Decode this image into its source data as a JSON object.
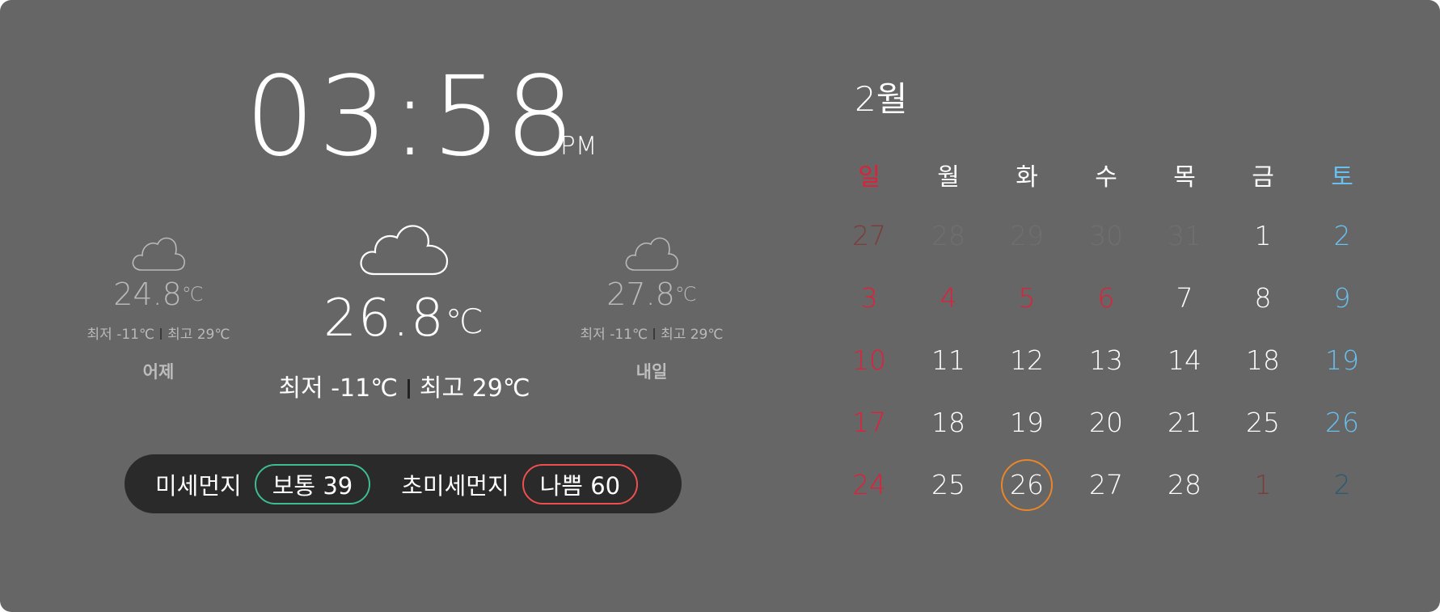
{
  "clock": {
    "time": "03:58",
    "ampm": "PM"
  },
  "weather": {
    "yesterday": {
      "icon": "cloud-icon",
      "temp": "24.8",
      "unit": "℃",
      "low": "최저 -11℃",
      "high": "최고 29℃",
      "day": "어제"
    },
    "today": {
      "icon": "cloud-icon",
      "temp": "26.8",
      "unit": "℃",
      "low": "최저 -11℃",
      "high": "최고 29℃"
    },
    "tomorrow": {
      "icon": "cloud-icon",
      "temp": "27.8",
      "unit": "℃",
      "low": "최저 -11℃",
      "high": "최고 29℃",
      "day": "내일"
    }
  },
  "air": {
    "pm10_label": "미세먼지",
    "pm10_value": "보통 39",
    "pm25_label": "초미세먼지",
    "pm25_value": "나쁨 60",
    "colors": {
      "good": "#3dbd8f",
      "bad": "#ef4f4f"
    }
  },
  "calendar": {
    "month": "2월",
    "weekdays": [
      "일",
      "월",
      "화",
      "수",
      "목",
      "금",
      "토"
    ],
    "weeks": [
      [
        "27",
        "28",
        "29",
        "30",
        "31",
        "1",
        "2"
      ],
      [
        "3",
        "4",
        "5",
        "6",
        "7",
        "8",
        "9"
      ],
      [
        "10",
        "11",
        "12",
        "13",
        "14",
        "18",
        "19"
      ],
      [
        "17",
        "18",
        "19",
        "20",
        "21",
        "25",
        "26"
      ],
      [
        "24",
        "25",
        "26",
        "27",
        "28",
        "1",
        "2"
      ]
    ],
    "today": "26",
    "colors": {
      "sunday": "#e0203a",
      "saturday": "#69bfed",
      "today_ring": "#e9862a"
    }
  }
}
